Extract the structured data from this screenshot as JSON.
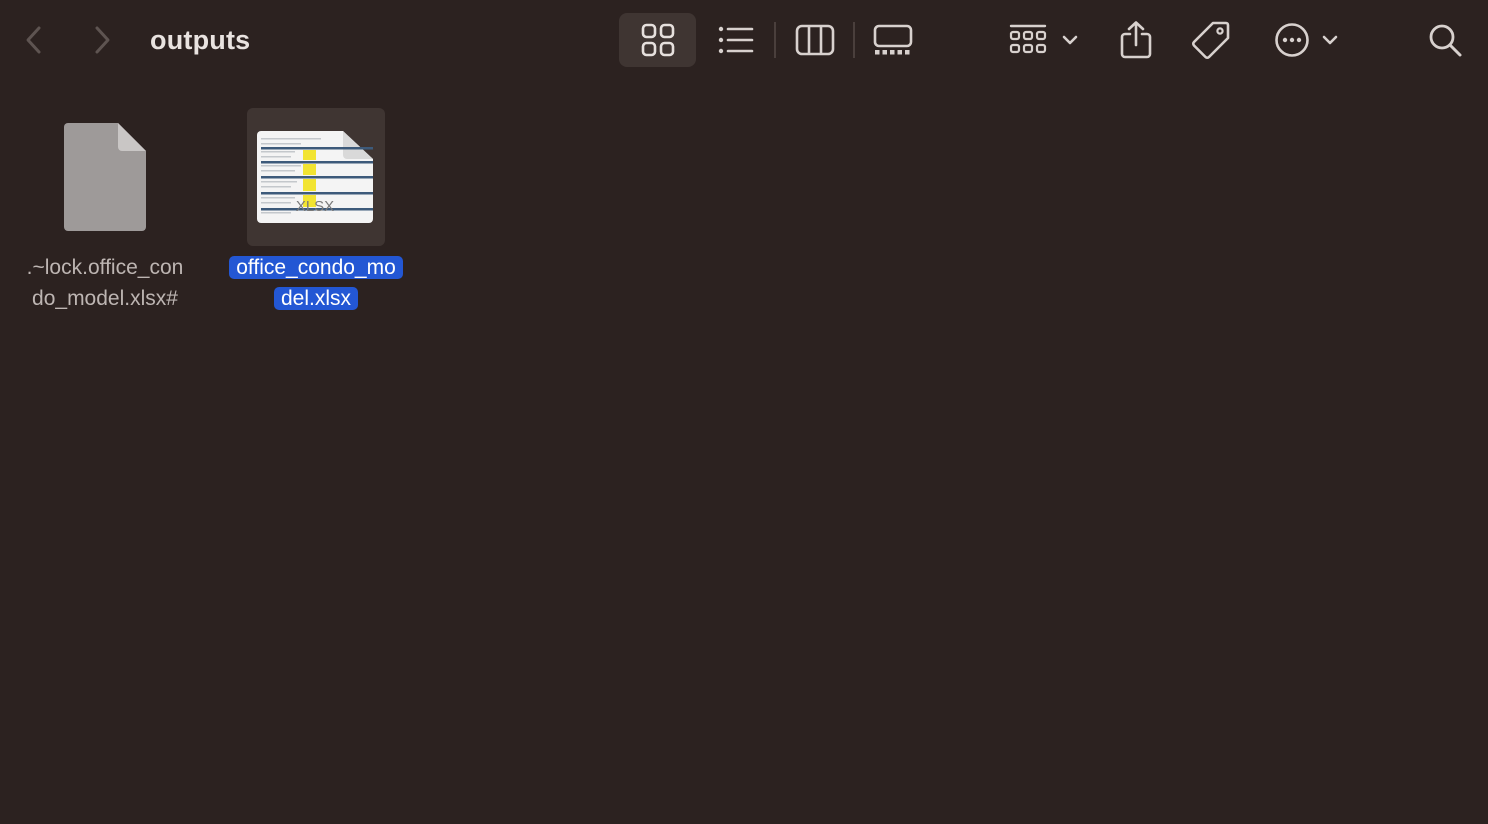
{
  "window": {
    "title": "outputs"
  },
  "toolbar": {
    "back_icon": "chevron-left-icon",
    "forward_icon": "chevron-right-icon",
    "view_icons_icon": "grid-icon",
    "view_list_icon": "list-icon",
    "view_columns_icon": "columns-icon",
    "view_gallery_icon": "gallery-icon",
    "group_icon": "group-grid-icon",
    "share_icon": "share-icon",
    "tag_icon": "tag-icon",
    "more_icon": "ellipsis-circle-icon",
    "search_icon": "search-icon",
    "active_view": "icons"
  },
  "files": [
    {
      "name_line1": ".~lock.office_con",
      "name_line2": "do_model.xlsx#",
      "icon": "generic-document-icon",
      "selected": false
    },
    {
      "name_line1": "office_condo_mo",
      "name_line2": "del.xlsx",
      "icon": "xlsx-thumbnail-icon",
      "thumbnail_label": "XLSX",
      "selected": true
    }
  ],
  "colors": {
    "background": "#2c2220",
    "selection": "#2357d4",
    "thumbnail_highlight": "#f2e432"
  }
}
